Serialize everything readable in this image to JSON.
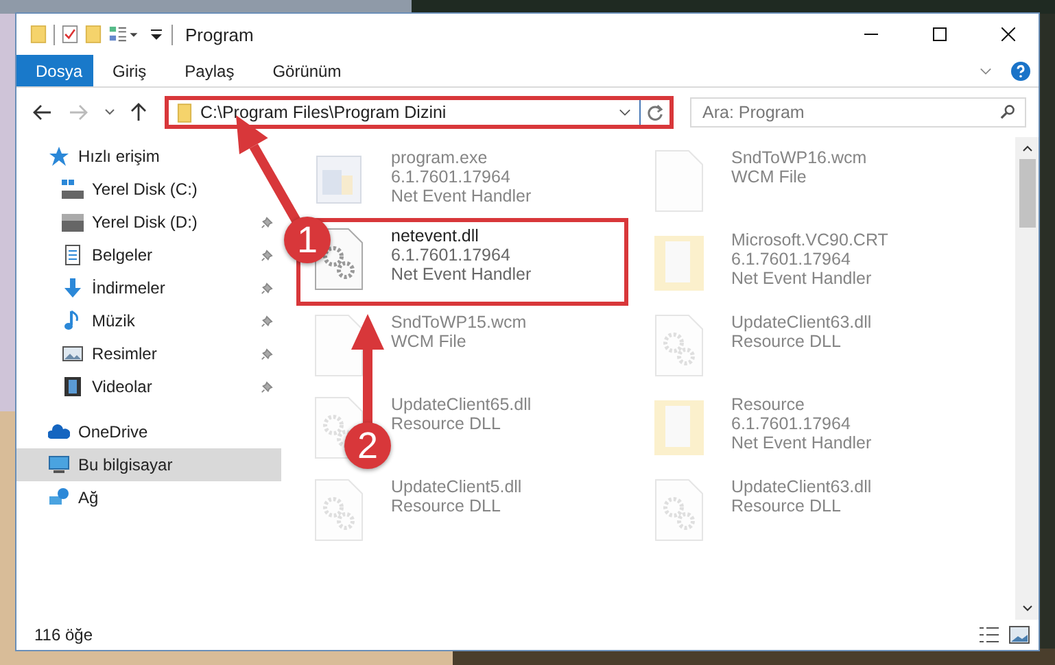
{
  "window": {
    "title": "Program"
  },
  "ribbon_tabs": [
    {
      "label": "Dosya",
      "selected": true
    },
    {
      "label": "Giriş",
      "selected": false
    },
    {
      "label": "Paylaş",
      "selected": false
    },
    {
      "label": "Görünüm",
      "selected": false
    }
  ],
  "address": {
    "value": "C:\\Program Files\\Program Dizini",
    "highlighted": true
  },
  "search": {
    "placeholder": "Ara: Program"
  },
  "sidebar": {
    "items": [
      {
        "label": "Hızlı erişim",
        "kind": "quick",
        "selected": false,
        "children": [
          {
            "label": "Yerel Disk (C:)",
            "kind": "system-drive",
            "pinned": false
          },
          {
            "label": "Yerel Disk (D:)",
            "kind": "drive",
            "pinned": true
          },
          {
            "label": "Belgeler",
            "kind": "documents",
            "pinned": true
          },
          {
            "label": "İndirmeler",
            "kind": "downloads",
            "pinned": true
          },
          {
            "label": "Müzik",
            "kind": "music",
            "pinned": true
          },
          {
            "label": "Resimler",
            "kind": "pictures",
            "pinned": true
          },
          {
            "label": "Videolar",
            "kind": "videos",
            "pinned": true
          }
        ]
      },
      {
        "label": "OneDrive",
        "kind": "cloud",
        "selected": false
      },
      {
        "label": "Bu bilgisayar",
        "kind": "computer",
        "selected": true
      },
      {
        "label": "Ağ",
        "kind": "network",
        "selected": false
      }
    ]
  },
  "files": [
    {
      "name": "program.exe",
      "lines": [
        "6.1.7601.17964",
        "Net Event Handler"
      ],
      "kind": "exe",
      "faded": true,
      "highlighted": false
    },
    {
      "name": "SndToWP16.wcm",
      "lines": [
        "WCM File"
      ],
      "kind": "blank",
      "faded": true,
      "highlighted": false
    },
    {
      "name": "netevent.dll",
      "lines": [
        "6.1.7601.17964",
        "Net Event Handler"
      ],
      "kind": "gears",
      "faded": false,
      "highlighted": true
    },
    {
      "name": "Microsoft.VC90.CRT",
      "lines": [
        "6.1.7601.17964",
        "Net Event Handler"
      ],
      "kind": "folder",
      "faded": true,
      "highlighted": false
    },
    {
      "name": "SndToWP15.wcm",
      "lines": [
        "WCM File"
      ],
      "kind": "blank",
      "faded": true,
      "highlighted": false
    },
    {
      "name": "UpdateClient63.dll",
      "lines": [
        "Resource DLL"
      ],
      "kind": "gears",
      "faded": true,
      "highlighted": false
    },
    {
      "name": "UpdateClient65.dll",
      "lines": [
        "Resource DLL"
      ],
      "kind": "gears",
      "faded": true,
      "highlighted": false
    },
    {
      "name": "Resource",
      "lines": [
        "6.1.7601.17964",
        "Net Event Handler"
      ],
      "kind": "folder",
      "faded": true,
      "highlighted": false
    },
    {
      "name": "UpdateClient5.dll",
      "lines": [
        "Resource DLL"
      ],
      "kind": "gears",
      "faded": true,
      "highlighted": false
    },
    {
      "name": "UpdateClient63.dll",
      "lines": [
        "Resource DLL"
      ],
      "kind": "gears",
      "faded": true,
      "highlighted": false
    }
  ],
  "status_bar": {
    "count": "116 öğe"
  },
  "annotations": [
    {
      "label": "1"
    },
    {
      "label": "2"
    }
  ]
}
